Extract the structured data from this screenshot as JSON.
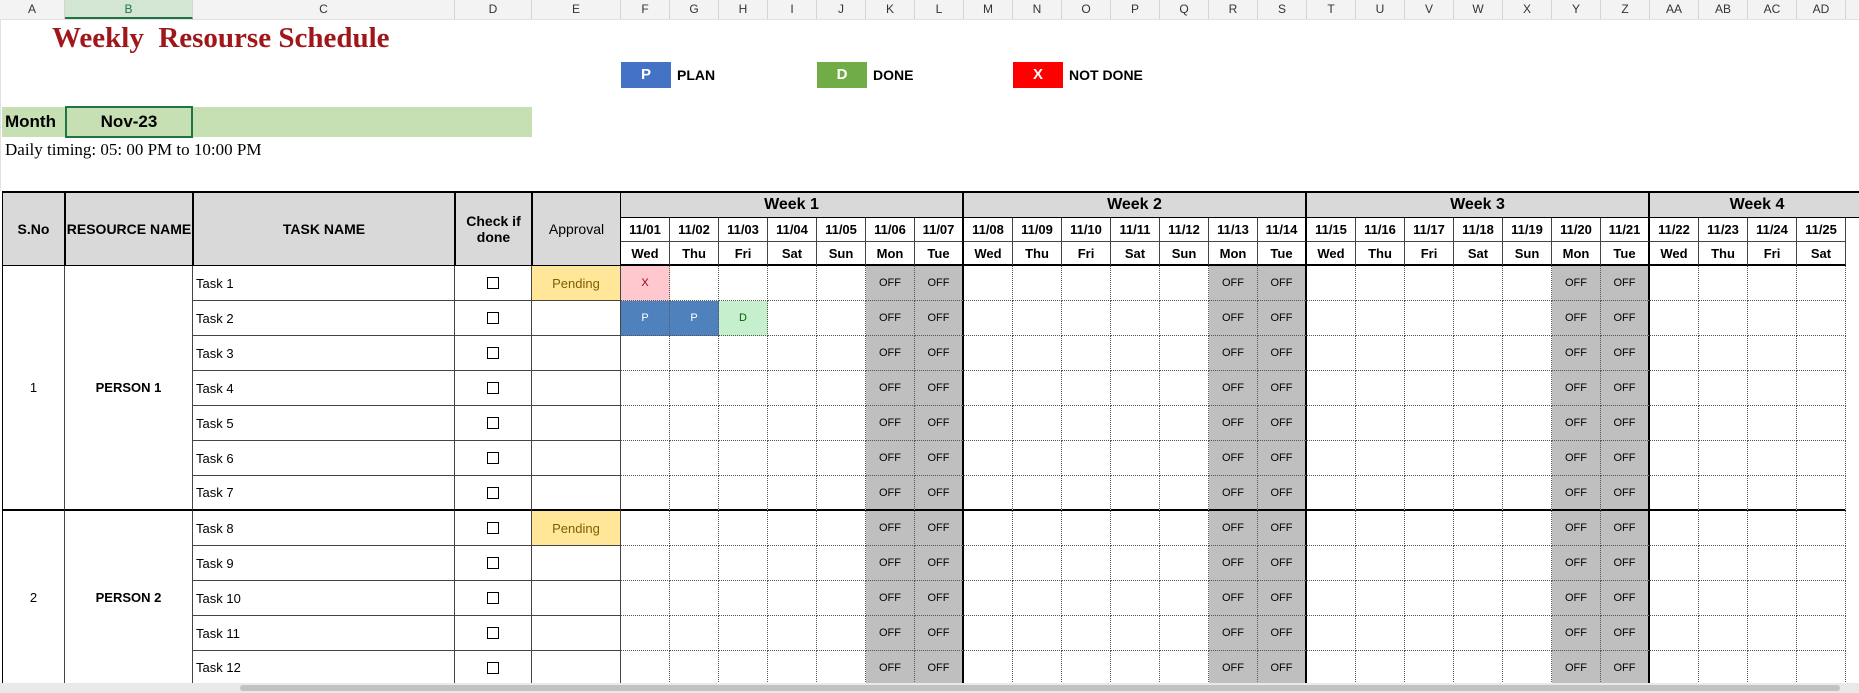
{
  "columns": [
    "A",
    "B",
    "C",
    "D",
    "E",
    "F",
    "G",
    "H",
    "I",
    "J",
    "K",
    "L",
    "M",
    "N",
    "O",
    "P",
    "Q",
    "R",
    "S",
    "T",
    "U",
    "V",
    "W",
    "X",
    "Y",
    "Z",
    "AA",
    "AB",
    "AC",
    "AD"
  ],
  "sheet_title": "Weekly  Resourse Schedule",
  "legend": [
    {
      "key": "P",
      "label": "PLAN",
      "color": "#4472c4"
    },
    {
      "key": "D",
      "label": "DONE",
      "color": "#70ad47"
    },
    {
      "key": "X",
      "label": "NOT DONE",
      "color": "#ff0000"
    }
  ],
  "month_label": "Month",
  "month_value": "Nov-23",
  "timing": "Daily timing: 05: 00 PM to 10:00 PM",
  "headers": {
    "sno": "S.No",
    "resource": "RESOURCE NAME",
    "task": "TASK NAME",
    "check": "Check if done",
    "approval": "Approval"
  },
  "weeks": [
    "Week 1",
    "Week 2",
    "Week 3",
    "Week 4"
  ],
  "dates": [
    "11/01",
    "11/02",
    "11/03",
    "11/04",
    "11/05",
    "11/06",
    "11/07",
    "11/08",
    "11/09",
    "11/10",
    "11/11",
    "11/12",
    "11/13",
    "11/14",
    "11/15",
    "11/16",
    "11/17",
    "11/18",
    "11/19",
    "11/20",
    "11/21",
    "11/22",
    "11/23",
    "11/24",
    "11/25"
  ],
  "days": [
    "Wed",
    "Thu",
    "Fri",
    "Sat",
    "Sun",
    "Mon",
    "Tue",
    "Wed",
    "Thu",
    "Fri",
    "Sat",
    "Sun",
    "Mon",
    "Tue",
    "Wed",
    "Thu",
    "Fri",
    "Sat",
    "Sun",
    "Mon",
    "Tue",
    "Wed",
    "Thu",
    "Fri",
    "Sat"
  ],
  "off_label": "OFF",
  "off_day_indices": [
    5,
    6,
    12,
    13,
    19,
    20
  ],
  "resources": [
    {
      "sno": "1",
      "name": "PERSON 1",
      "tasks": [
        {
          "name": "Task 1",
          "approval": "Pending",
          "marks": {
            "0": "X"
          }
        },
        {
          "name": "Task 2",
          "approval": "",
          "marks": {
            "0": "P",
            "1": "P",
            "2": "D"
          }
        },
        {
          "name": "Task 3",
          "approval": "",
          "marks": {}
        },
        {
          "name": "Task 4",
          "approval": "",
          "marks": {}
        },
        {
          "name": "Task 5",
          "approval": "",
          "marks": {}
        },
        {
          "name": "Task 6",
          "approval": "",
          "marks": {}
        },
        {
          "name": "Task 7",
          "approval": "",
          "marks": {}
        }
      ]
    },
    {
      "sno": "2",
      "name": "PERSON 2",
      "tasks": [
        {
          "name": "Task 8",
          "approval": "Pending",
          "marks": {}
        },
        {
          "name": "Task 9",
          "approval": "",
          "marks": {}
        },
        {
          "name": "Task 10",
          "approval": "",
          "marks": {}
        },
        {
          "name": "Task 11",
          "approval": "",
          "marks": {}
        },
        {
          "name": "Task 12",
          "approval": "",
          "marks": {}
        }
      ]
    }
  ]
}
